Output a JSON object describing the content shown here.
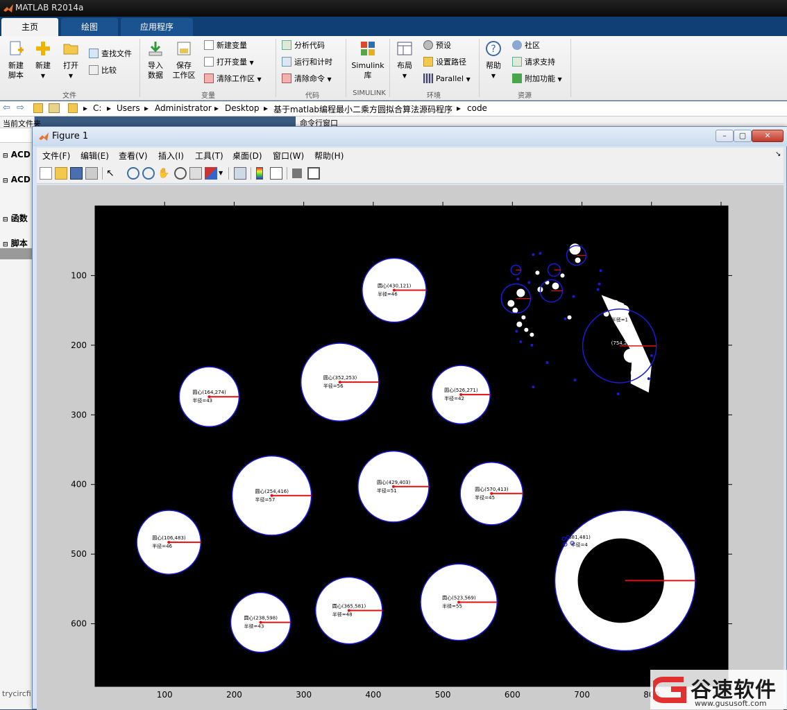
{
  "app": {
    "title": "MATLAB R2014a"
  },
  "tabs": [
    {
      "label": "主页",
      "active": true
    },
    {
      "label": "绘图",
      "active": false
    },
    {
      "label": "应用程序",
      "active": false
    }
  ],
  "ribbon": {
    "file": {
      "new_script": "新建\n脚本",
      "new": "新建",
      "open": "打开",
      "find_files": "查找文件",
      "compare": "比较",
      "group": "文件"
    },
    "variable": {
      "import": "导入\n数据",
      "save": "保存\n工作区",
      "new_var": "新建变量",
      "open_var": "打开变量",
      "clear_ws": "清除工作区",
      "group": "变量"
    },
    "code": {
      "analyze": "分析代码",
      "run_time": "运行和计时",
      "clear_cmd": "清除命令",
      "group": "代码"
    },
    "simulink": {
      "lib": "Simulink\n库",
      "group": "SIMULINK"
    },
    "env": {
      "layout": "布局",
      "prefs": "预设",
      "set_path": "设置路径",
      "parallel": "Parallel",
      "group": "环境"
    },
    "resources": {
      "help": "帮助",
      "community": "社区",
      "support": "请求支持",
      "addons": "附加功能",
      "group": "资源"
    }
  },
  "address": {
    "path": [
      "C:",
      "Users",
      "Administrator",
      "Desktop",
      "基于matlab编程最小二乘方圆拟合算法源码程序",
      "code"
    ]
  },
  "left": {
    "current_folder": "当前文件夹",
    "items": [
      "ACD",
      "ACD",
      "函数",
      "脚本"
    ],
    "file": "trycircfi",
    "command_window": "命令行窗口"
  },
  "figure": {
    "title": "Figure 1",
    "menu": [
      "文件(F)",
      "编辑(E)",
      "查看(V)",
      "插入(I)",
      "工具(T)",
      "桌面(D)",
      "窗口(W)",
      "帮助(H)"
    ]
  },
  "watermark": {
    "brand": "谷速软件",
    "url": "www.gususoft.com"
  },
  "chart_data": {
    "type": "scatter",
    "xlim": [
      0,
      910
    ],
    "ylim": [
      0,
      690
    ],
    "y_reversed": true,
    "x_ticks": [
      100,
      200,
      300,
      400,
      500,
      600,
      700,
      800,
      900
    ],
    "y_ticks": [
      100,
      200,
      300,
      400,
      500,
      600
    ],
    "background": "#000000",
    "circle_color": "#1a1ad8",
    "radius_line_color": "#e01010",
    "circles": [
      {
        "cx": 430,
        "cy": 121,
        "r": 46,
        "center_label": "圆心(430,121)",
        "radius_label": "半径=46"
      },
      {
        "cx": 352,
        "cy": 253,
        "r": 56,
        "center_label": "圆心(352,253)",
        "radius_label": "半径=56"
      },
      {
        "cx": 164,
        "cy": 274,
        "r": 43,
        "center_label": "圆心(164,274)",
        "radius_label": "半径=43"
      },
      {
        "cx": 526,
        "cy": 271,
        "r": 42,
        "center_label": "圆心(526,271)",
        "radius_label": "半径=42"
      },
      {
        "cx": 254,
        "cy": 416,
        "r": 57,
        "center_label": "圆心(254,416)",
        "radius_label": "半径=57"
      },
      {
        "cx": 429,
        "cy": 403,
        "r": 51,
        "center_label": "圆心(429,403)",
        "radius_label": "半径=51"
      },
      {
        "cx": 570,
        "cy": 413,
        "r": 45,
        "center_label": "圆心(570,413)",
        "radius_label": "半径=45"
      },
      {
        "cx": 106,
        "cy": 483,
        "r": 46,
        "center_label": "圆心(106,483)",
        "radius_label": "半径=46"
      },
      {
        "cx": 238,
        "cy": 598,
        "r": 43,
        "center_label": "圆心(238,598)",
        "radius_label": "半径=43"
      },
      {
        "cx": 365,
        "cy": 581,
        "r": 48,
        "center_label": "圆心(365,581)",
        "radius_label": "半径=48"
      },
      {
        "cx": 523,
        "cy": 569,
        "r": 55,
        "center_label": "圆心(523,569)",
        "radius_label": "半径=55"
      }
    ],
    "ring": {
      "cx": 762,
      "cy": 538,
      "r_outer": 101,
      "r_inner": 62
    },
    "big_blue_circle": {
      "cx": 754,
      "cy": 201,
      "r": 53,
      "label": "(754,201)"
    },
    "small_blue_circles": [
      {
        "cx": 605,
        "cy": 133,
        "r": 21
      },
      {
        "cx": 656,
        "cy": 122,
        "r": 16
      },
      {
        "cx": 692,
        "cy": 71,
        "r": 14
      },
      {
        "cx": 660,
        "cy": 92,
        "r": 9
      },
      {
        "cx": 605,
        "cy": 92,
        "r": 7
      }
    ],
    "ring_labels": [
      "(681,481)",
      "半径=4"
    ],
    "small_label": "半径=1"
  }
}
